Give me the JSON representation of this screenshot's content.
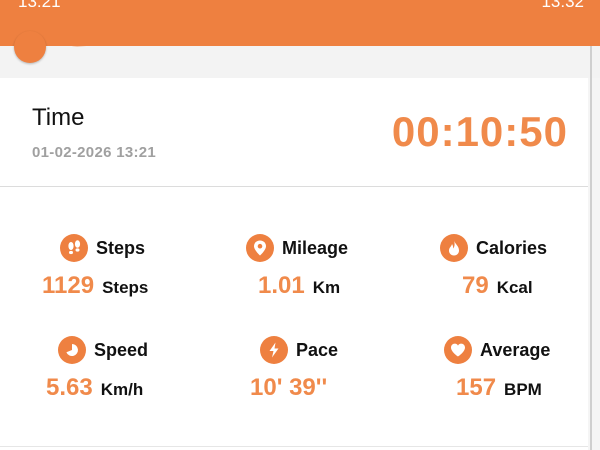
{
  "status_bar": {
    "time_left": "13:21",
    "time_right": "13:32"
  },
  "colors": {
    "accent": "#ee8040",
    "value": "#f08a4b",
    "muted": "#a0a0a0"
  },
  "summary": {
    "title": "Time",
    "date": "01-02-2026 13:21",
    "duration": "00:10:50"
  },
  "stats": [
    {
      "label": "Steps",
      "value": "1129",
      "unit": "Steps",
      "icon": "footprints-icon"
    },
    {
      "label": "Mileage",
      "value": "1.01",
      "unit": "Km",
      "icon": "location-pin-icon"
    },
    {
      "label": "Calories",
      "value": "79",
      "unit": "Kcal",
      "icon": "flame-icon"
    },
    {
      "label": "Speed",
      "value": "5.63",
      "unit": "Km/h",
      "icon": "clock-icon"
    },
    {
      "label": "Pace",
      "value": "10' 39''",
      "unit": "",
      "icon": "lightning-icon"
    },
    {
      "label": "Average",
      "value": "157",
      "unit": "BPM",
      "icon": "heart-icon"
    }
  ]
}
